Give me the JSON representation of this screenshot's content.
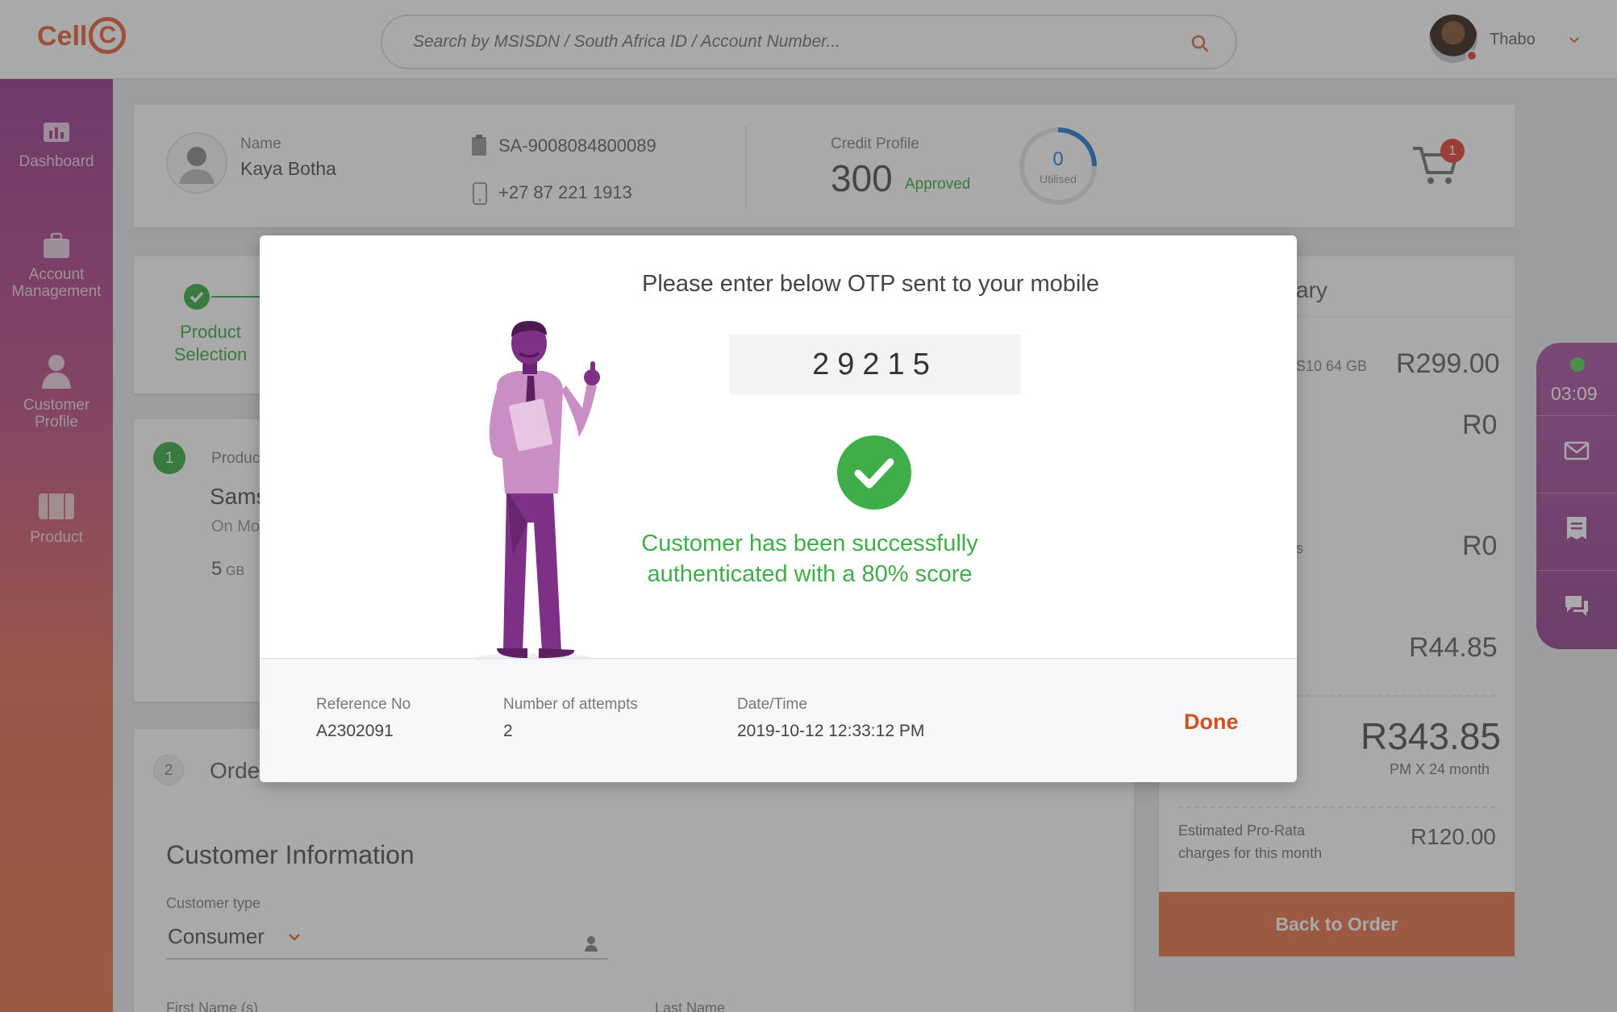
{
  "brand": {
    "logo_text": "Cell",
    "logo_c": "C",
    "accent": "#e8663d"
  },
  "search": {
    "placeholder": "Search by MSISDN / South Africa ID / Account Number..."
  },
  "user": {
    "name": "Thabo"
  },
  "sidebar": {
    "items": [
      {
        "label": "Dashboard",
        "icon": "chart-icon"
      },
      {
        "label": "Account Management",
        "icon": "briefcase-icon"
      },
      {
        "label": "Customer Profile",
        "icon": "person-icon"
      },
      {
        "label": "Product",
        "icon": "product-icon"
      }
    ]
  },
  "customer": {
    "name_label": "Name",
    "name": "Kaya Botha",
    "id_number": "SA-9008084800089",
    "phone": "+27 87 221 1913",
    "credit_label": "Credit Profile",
    "credit_score": "300",
    "credit_status": "Approved",
    "utilised_value": "0",
    "utilised_label": "Utilised",
    "cart_count": "1"
  },
  "steps": {
    "step1_label": "Product Selection"
  },
  "product_card": {
    "index": "1",
    "title_partial": "Produc",
    "name_partial": "Sams",
    "plan_partial": "On Mo",
    "data_value": "5",
    "data_unit": "GB"
  },
  "order_card": {
    "index": "2",
    "title_partial": "Orde",
    "section_title": "Customer Information",
    "customer_type_label": "Customer type",
    "customer_type_value": "Consumer",
    "first_name_label": "First Name (s)",
    "last_name_label": "Last Name"
  },
  "summary": {
    "title_partial": "ary",
    "item_label": "S10 64 GB",
    "item_price": "R299.00",
    "line2": "R0",
    "line3_partial": "s",
    "line3": "R0",
    "line4": "R44.85",
    "total": "R343.85",
    "total_sub": "PM X 24 month",
    "prorata_label_1": "Estimated Pro-Rata",
    "prorata_label_2": "charges for this month",
    "prorata_value": "R120.00",
    "back_button": "Back to Order"
  },
  "timer": {
    "time": "03:09"
  },
  "modal": {
    "heading": "Please enter below OTP sent to your mobile",
    "otp": "29215",
    "success_line1": "Customer has been successfully",
    "success_line2": "authenticated with a 80% score",
    "success_color": "#3fae49",
    "ref_label": "Reference No",
    "ref_value": "A2302091",
    "attempts_label": "Number of attempts",
    "attempts_value": "2",
    "datetime_label": "Date/Time",
    "datetime_value": "2019-10-12 12:33:12 PM",
    "done_label": "Done"
  }
}
